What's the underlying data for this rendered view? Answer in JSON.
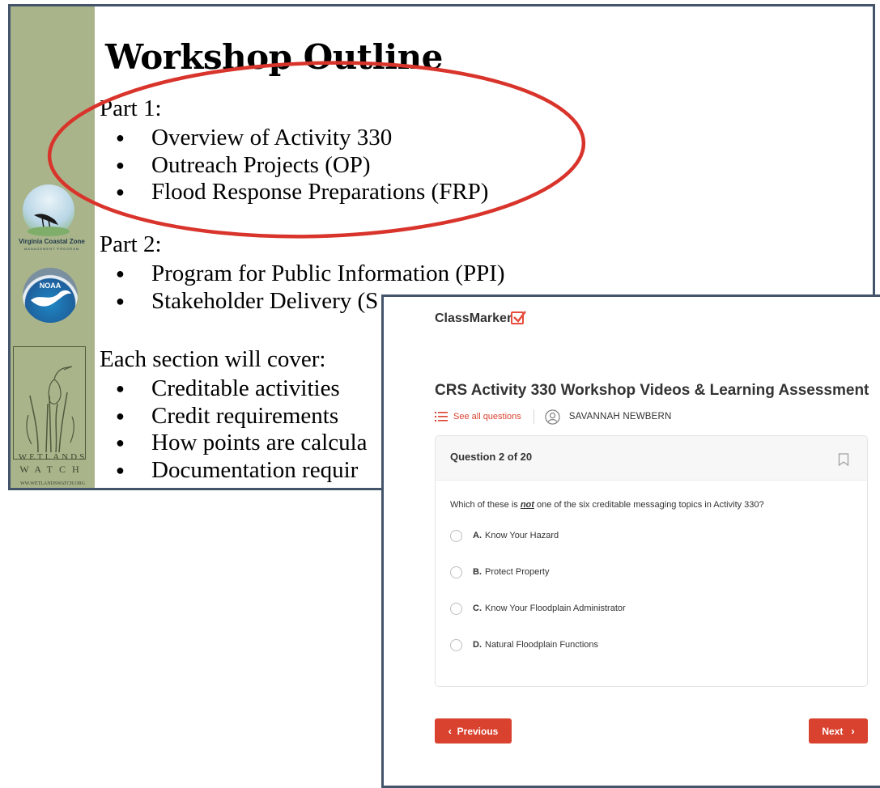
{
  "slide": {
    "title": "Workshop Outline",
    "part1": {
      "heading": "Part 1:",
      "items": [
        "Overview of Activity 330",
        "Outreach Projects (OP)",
        "Flood Response Preparations (FRP)"
      ]
    },
    "part2": {
      "heading": "Part 2:",
      "items": [
        "Program for Public Information (PPI)",
        "Stakeholder Delivery (S"
      ]
    },
    "section": {
      "heading": "Each section will cover:",
      "items": [
        "Creditable activities",
        "Credit requirements",
        "How points are calcula",
        "Documentation requir"
      ]
    },
    "logos": {
      "vcz_name": "Virginia Coastal Zone",
      "vcz_sub": "MANAGEMENT PROGRAM",
      "noaa": "NOAA",
      "wetlands_line1": "WETLANDS",
      "wetlands_line2": "WATCH",
      "wetlands_url": "WW.WETLANDSWATCH.ORG"
    },
    "highlight_color": "#d9342b",
    "sidebar_color": "#a9b48b"
  },
  "quiz": {
    "brand": "ClassMarker",
    "title": "CRS Activity 330 Workshop Videos & Learning Assessment",
    "see_all": "See all questions",
    "user_name": "SAVANNAH NEWBERN",
    "question_number": "Question 2 of 20",
    "question_prefix": "Which of these is ",
    "question_emphasis": "not",
    "question_suffix": " one of the six creditable messaging topics in Activity 330?",
    "options": [
      {
        "letter": "A.",
        "text": "Know Your Hazard"
      },
      {
        "letter": "B.",
        "text": "Protect Property"
      },
      {
        "letter": "C.",
        "text": "Know Your Floodplain Administrator"
      },
      {
        "letter": "D.",
        "text": "Natural Floodplain Functions"
      }
    ],
    "prev_label": "Previous",
    "next_label": "Next",
    "prev_icon": "chevron-left",
    "next_icon": "chevron-right",
    "accent_color": "#d9422f"
  }
}
